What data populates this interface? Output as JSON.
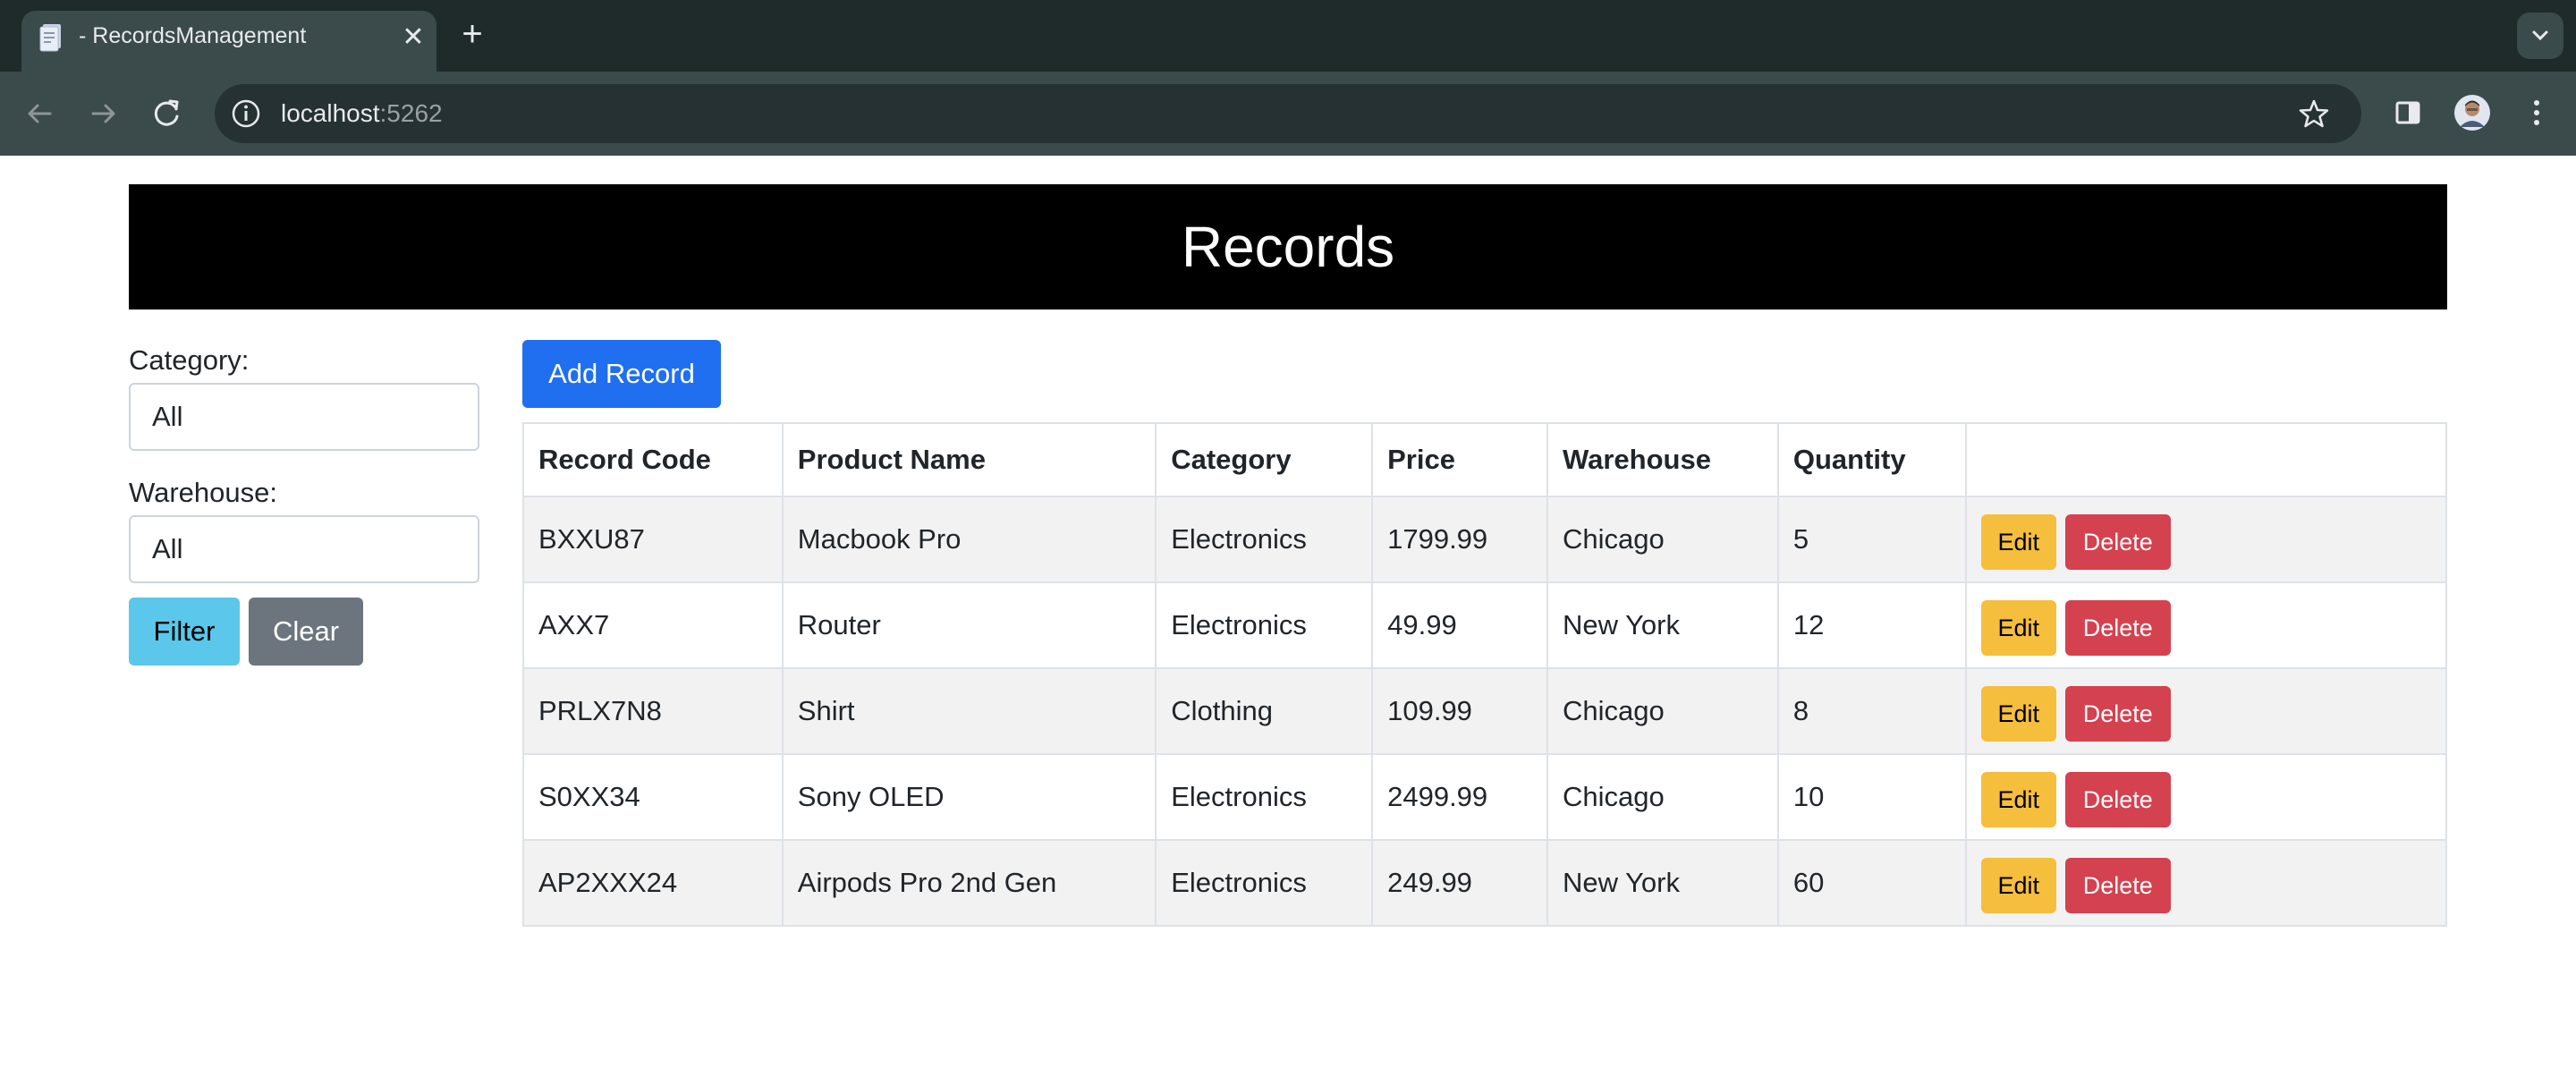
{
  "browser": {
    "tab_title": "- RecordsManagement",
    "url_host": "localhost",
    "url_port": ":5262",
    "icons": {
      "back": "arrow-left-icon",
      "forward": "arrow-right-icon",
      "reload": "reload-icon",
      "info": "info-icon",
      "bookmark": "star-icon",
      "side_panel": "side-panel-icon",
      "profile": "avatar",
      "menu": "kebab-menu-icon"
    }
  },
  "page": {
    "title": "Records",
    "filters": {
      "category_label": "Category:",
      "category_value": "All",
      "warehouse_label": "Warehouse:",
      "warehouse_value": "All",
      "filter_label": "Filter",
      "clear_label": "Clear"
    },
    "add_record_label": "Add Record",
    "table": {
      "columns": [
        "Record Code",
        "Product Name",
        "Category",
        "Price",
        "Warehouse",
        "Quantity",
        ""
      ],
      "rows": [
        {
          "code": "BXXU87",
          "name": "Macbook Pro",
          "category": "Electronics",
          "price": "1799.99",
          "warehouse": "Chicago",
          "quantity": "5"
        },
        {
          "code": "AXX7",
          "name": "Router",
          "category": "Electronics",
          "price": "49.99",
          "warehouse": "New York",
          "quantity": "12"
        },
        {
          "code": "PRLX7N8",
          "name": "Shirt",
          "category": "Clothing",
          "price": "109.99",
          "warehouse": "Chicago",
          "quantity": "8"
        },
        {
          "code": "S0XX34",
          "name": "Sony OLED",
          "category": "Electronics",
          "price": "2499.99",
          "warehouse": "Chicago",
          "quantity": "10"
        },
        {
          "code": "AP2XXX24",
          "name": "Airpods Pro 2nd Gen",
          "category": "Electronics",
          "price": "249.99",
          "warehouse": "New York",
          "quantity": "60"
        }
      ],
      "edit_label": "Edit",
      "delete_label": "Delete"
    }
  },
  "colors": {
    "header_bg": "#000000",
    "primary": "#1f6ff0",
    "info": "#5bc7ea",
    "secondary": "#6c757d",
    "warning": "#f5be3d",
    "danger": "#d4414f"
  }
}
